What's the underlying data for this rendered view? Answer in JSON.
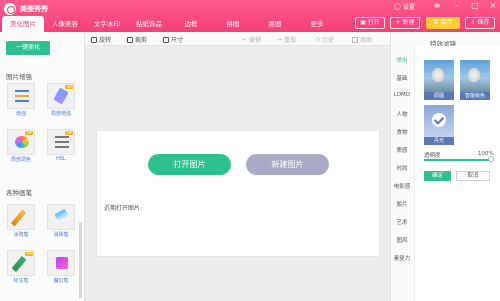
{
  "app": {
    "title": "美图秀秀"
  },
  "tabs": [
    "美化图片",
    "人像美容",
    "文字水印",
    "贴纸饰品",
    "边框",
    "拼图",
    "抠图",
    "更多"
  ],
  "top_right": {
    "settings": "设置",
    "open": "打开",
    "new": "新建",
    "vip": "会员",
    "save": "保存"
  },
  "toolbar": {
    "rotate": "旋转",
    "crop": "裁剪",
    "size": "尺寸",
    "undo": "撤销",
    "redo": "重做",
    "history": "历史",
    "original": "原图"
  },
  "left": {
    "onekey": "一键美化",
    "section1": "图片增强",
    "enhance_tools": [
      {
        "label": "增强",
        "badge": ""
      },
      {
        "label": "局部增强",
        "badge": "VIP"
      },
      {
        "label": "局部调色",
        "badge": "VIP"
      },
      {
        "label": "HSL",
        "badge": "VIP"
      }
    ],
    "section2": "各种画笔",
    "pen_tools": [
      {
        "label": "涂鸦笔",
        "badge": ""
      },
      {
        "label": "消除笔",
        "badge": ""
      },
      {
        "label": "标注笔",
        "badge": "VIP"
      },
      {
        "label": "魔幻笔",
        "badge": ""
      }
    ]
  },
  "canvas": {
    "open_button": "打开图片",
    "new_button": "新建图片",
    "recent_label": "近期打开图片:"
  },
  "right": {
    "title": "特效滤镜",
    "categories": [
      "常用",
      "基础",
      "LOMO",
      "人物",
      "食物",
      "质感",
      "时尚",
      "电影感",
      "胶片",
      "艺术",
      "图风",
      "素复力"
    ],
    "active_category": "常用",
    "filters": [
      "原图",
      "智能绘色",
      "丹光"
    ],
    "opacity_label": "透明度",
    "opacity_value": "100%",
    "opacity_level": 1.0,
    "ok": "确定",
    "cancel": "取消"
  },
  "colors": {
    "brand": "#f43f78",
    "accent": "#2fc08f"
  }
}
